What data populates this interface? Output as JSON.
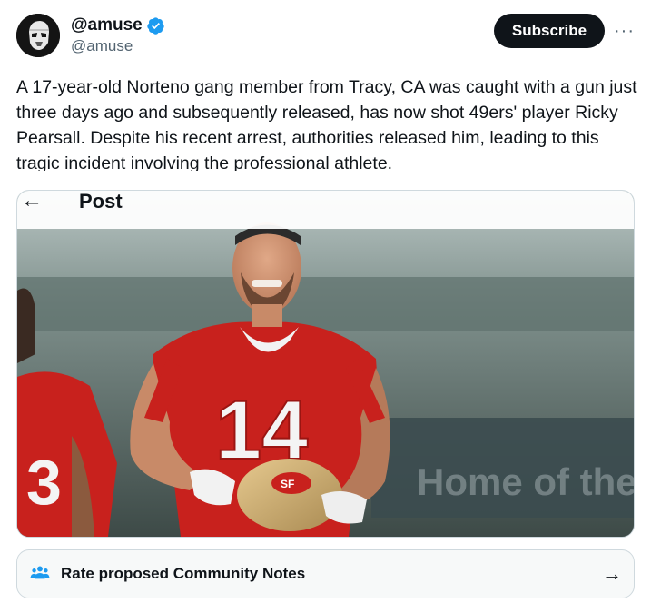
{
  "author": {
    "display_name": "@amuse",
    "handle": "@amuse",
    "verified": true,
    "avatar_icon": "stormtrooper-avatar"
  },
  "actions": {
    "subscribe_label": "Subscribe",
    "more_label": "···"
  },
  "tweet": {
    "text": "A 17-year-old Norteno gang member from Tracy, CA was caught with a gun just three days ago and subsequently released, has now shot 49ers' player Ricky Pearsall. Despite his recent arrest, authorities released him, leading to this tragic incident involving the professional athlete."
  },
  "media": {
    "header_back": "←",
    "header_title": "Post",
    "jersey_number": "14"
  },
  "community_notes": {
    "label": "Rate proposed Community Notes",
    "arrow": "→"
  },
  "colors": {
    "accent": "#1d9bf0",
    "text": "#0f1419",
    "secondary": "#536471",
    "jersey_red": "#c8211d"
  }
}
